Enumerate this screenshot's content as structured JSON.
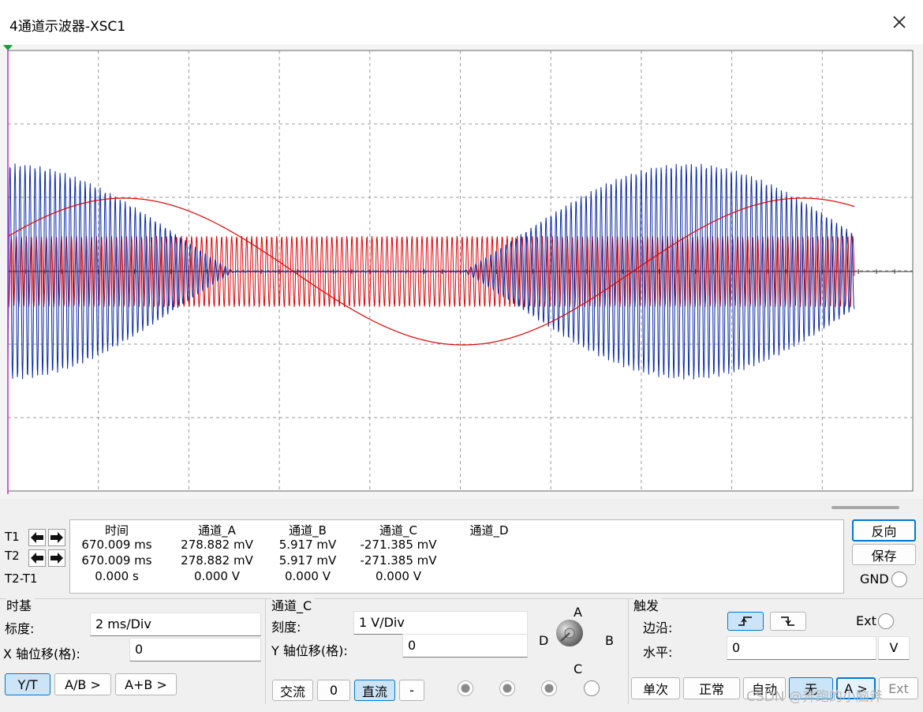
{
  "window": {
    "title": "4通道示波器-XSC1"
  },
  "scope": {
    "colors": {
      "channel_a": "#e00000",
      "channel_b": "#0a2aa8",
      "grid": "#9a9a9a",
      "background": "#ffffff",
      "cursor": "#cc33cc"
    },
    "traces": [
      {
        "channel": "A",
        "kind": "carrier-amplitude-modulated",
        "color": "#0a2aa8"
      },
      {
        "channel": "B",
        "kind": "carrier-constant",
        "color": "#e00000"
      },
      {
        "channel": "C",
        "kind": "sine-modulating",
        "color": "#e00000"
      }
    ]
  },
  "cursors": {
    "t1_label": "T1",
    "t2_label": "T2",
    "diff_label": "T2-T1"
  },
  "readout": {
    "headers": [
      "时间",
      "通道_A",
      "通道_B",
      "通道_C",
      "通道_D"
    ],
    "rows": [
      [
        "670.009 ms",
        "278.882 mV",
        "5.917 mV",
        "-271.385 mV",
        ""
      ],
      [
        "670.009 ms",
        "278.882 mV",
        "5.917 mV",
        "-271.385 mV",
        ""
      ],
      [
        "0.000 s",
        "0.000 V",
        "0.000 V",
        "0.000 V",
        ""
      ]
    ]
  },
  "side_buttons": {
    "reverse": "反向",
    "save": "保存",
    "gnd": "GND"
  },
  "timebase": {
    "group": "时基",
    "scale_label": "标度:",
    "scale_value": "2 ms/Div",
    "xpos_label": "X 轴位移(格):",
    "xpos_value": "0",
    "modes": [
      "Y/T",
      "A/B >",
      "A+B >"
    ]
  },
  "channel": {
    "group": "通道_C",
    "scale_label": "刻度:",
    "scale_value": "1  V/Div",
    "ypos_label": "Y 轴位移(格):",
    "ypos_value": "0",
    "coupling": [
      "交流",
      "0",
      "直流",
      "-"
    ],
    "knob_labels": {
      "a": "A",
      "b": "B",
      "c": "C",
      "d": "D"
    }
  },
  "trigger": {
    "group": "触发",
    "edge_label": "边沿:",
    "ext_label": "Ext",
    "level_label": "水平:",
    "level_value": "0",
    "level_unit": "V",
    "modes": [
      "单次",
      "正常",
      "自动",
      "无"
    ],
    "source_a": "A >",
    "source_ext": "Ext"
  },
  "watermark": "CSDN @奔跑的小脑斧"
}
